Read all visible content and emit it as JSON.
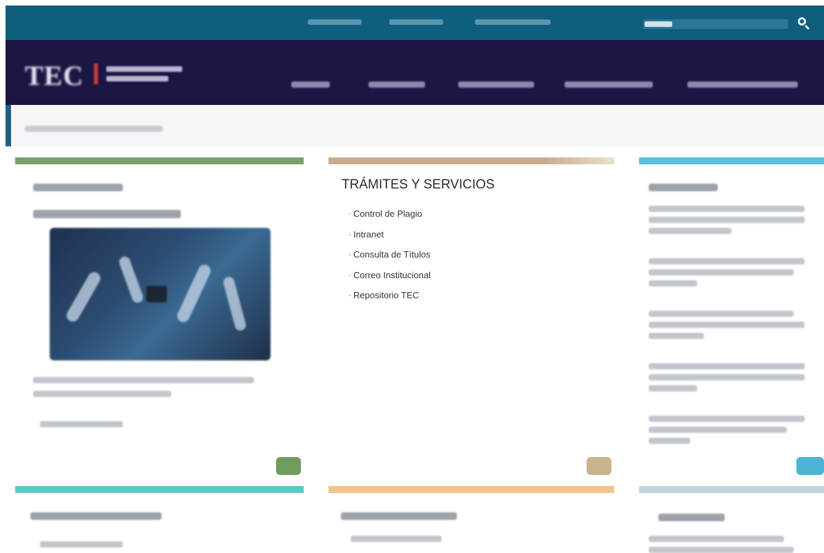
{
  "tramites": {
    "title": "TRÁMITES Y SERVICIOS",
    "links": [
      "Control de Plagio",
      "Intranet",
      "Consulta de Títulos",
      "Correo Institucional",
      "Repositorio TEC"
    ]
  },
  "colors": {
    "topbar": "#0f5e7e",
    "navbar": "#1c1645",
    "green": "#7aa06a",
    "tan": "#c8ac8c",
    "cyan": "#5bc0de",
    "teal": "#5cc7c3",
    "orange": "#f2c38a",
    "grayblue": "#c5d3dc"
  },
  "icons": {
    "search": "search-icon",
    "play": "play-icon"
  }
}
